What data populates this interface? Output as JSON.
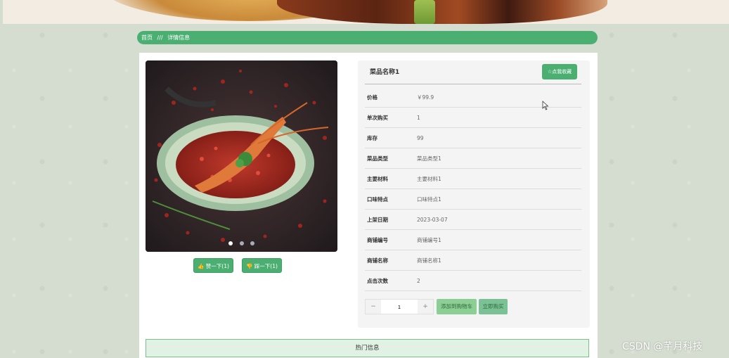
{
  "breadcrumb": {
    "home": "首页",
    "separator": "///",
    "current": "详情信息"
  },
  "product": {
    "name": "菜品名称1",
    "favorite_label": "☆点我收藏",
    "fields": [
      {
        "label": "价格",
        "value": "￥99.9"
      },
      {
        "label": "单次购买",
        "value": "1"
      },
      {
        "label": "库存",
        "value": "99"
      },
      {
        "label": "菜品类型",
        "value": "菜品类型1"
      },
      {
        "label": "主要材料",
        "value": "主要材料1"
      },
      {
        "label": "口味特点",
        "value": "口味特点1"
      },
      {
        "label": "上架日期",
        "value": "2023-03-07"
      },
      {
        "label": "商铺编号",
        "value": "商铺编号1"
      },
      {
        "label": "商铺名称",
        "value": "商铺名称1"
      },
      {
        "label": "点击次数",
        "value": "2"
      }
    ]
  },
  "gallery": {
    "active_dot": 1,
    "total_dots": 3
  },
  "votes": {
    "up_label": "👍 赞一下(1)",
    "down_label": "👎 踩一下(1)"
  },
  "purchase": {
    "minus": "−",
    "plus": "+",
    "quantity": "1",
    "add_cart_label": "添加到购物车",
    "buy_now_label": "立即购买"
  },
  "hot_section": {
    "title": "热门信息"
  },
  "watermark": "CSDN @芊月科技",
  "colors": {
    "accent": "#4caf72",
    "card": "#ffffff",
    "panel": "#f4f4f4"
  }
}
